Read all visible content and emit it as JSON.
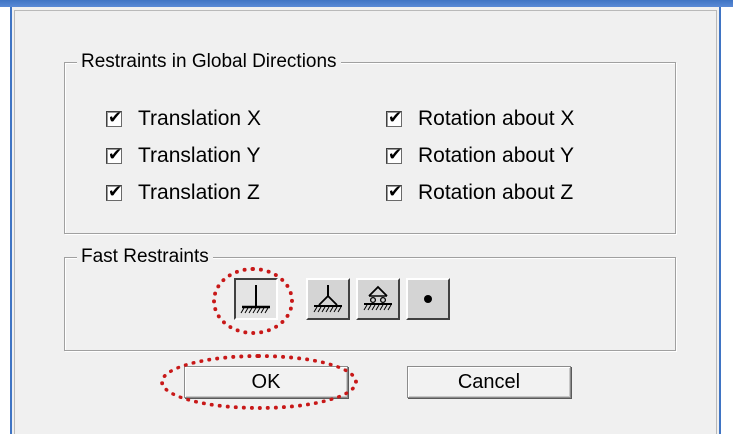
{
  "restraints_group": {
    "legend": "Restraints in Global Directions",
    "translations": [
      {
        "label": "Translation X",
        "checked": true
      },
      {
        "label": "Translation Y",
        "checked": true
      },
      {
        "label": "Translation Z",
        "checked": true
      }
    ],
    "rotations": [
      {
        "label": "Rotation about X",
        "checked": true
      },
      {
        "label": "Rotation about Y",
        "checked": true
      },
      {
        "label": "Rotation about Z",
        "checked": true
      }
    ],
    "check_glyph": "✔"
  },
  "fast_restraints_group": {
    "legend": "Fast Restraints",
    "buttons": [
      {
        "icon": "fixed-support-icon",
        "pressed": true
      },
      {
        "icon": "pinned-support-icon",
        "pressed": false
      },
      {
        "icon": "roller-support-icon",
        "pressed": false
      },
      {
        "icon": "free-joint-icon",
        "pressed": false
      }
    ]
  },
  "buttons": {
    "ok_label": "OK",
    "cancel_label": "Cancel"
  },
  "annotations": {
    "highlight_color": "#c81818"
  },
  "colors": {
    "title_bar": "#3f74c4",
    "dialog_face": "#f0f0f0"
  }
}
